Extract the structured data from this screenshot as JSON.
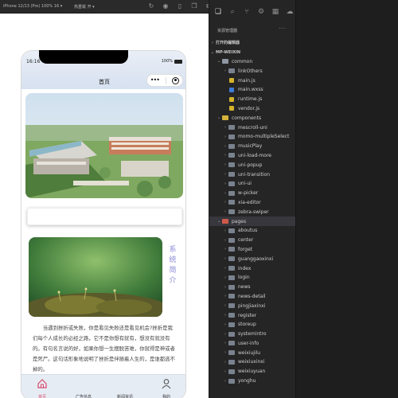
{
  "toolbar": {
    "device": "iPhone 12/13 (Pro) 100% 16 ▾",
    "hot_reload": "热重载 开 ▾",
    "icons": [
      "refresh-icon",
      "record-icon",
      "phone-icon",
      "copy-icon",
      "preview-icon"
    ]
  },
  "phone": {
    "time": "16:16",
    "battery": "100%",
    "nav_title": "首页",
    "intro_title": "系统简介",
    "intro_text": "当遇到挫折或失败，你是看见失败还是看见机会?挫折是我们每个人成长的必经之路，它不是你想有就有，想没有就没有的。有句名言说的好，如果你想一生摆脱苦难，你就得是神或者是死尸。这句话形象地说明了挫折是伴随着人生的，是谁都逃不掉的。",
    "tabs": [
      {
        "label": "首页",
        "active": true
      },
      {
        "label": "广告信息",
        "active": false
      },
      {
        "label": "新闻资讯",
        "active": false
      },
      {
        "label": "我的",
        "active": false
      }
    ]
  },
  "explorer": {
    "title": "资源管理器",
    "more": "···",
    "sections": {
      "open_editors": "打开的编辑器",
      "project": "MP-WEIXIN"
    },
    "tree": [
      {
        "label": "common",
        "type": "folder",
        "open": true,
        "depth": 1
      },
      {
        "label": "linkOthers",
        "type": "folder",
        "open": false,
        "depth": 2
      },
      {
        "label": "main.js",
        "type": "js",
        "depth": 2
      },
      {
        "label": "main.wxss",
        "type": "wxss",
        "depth": 2
      },
      {
        "label": "runtime.js",
        "type": "js",
        "depth": 2
      },
      {
        "label": "vendor.js",
        "type": "js",
        "depth": 2
      },
      {
        "label": "components",
        "type": "folder-yellow",
        "open": true,
        "depth": 1
      },
      {
        "label": "mescroll-uni",
        "type": "folder",
        "open": false,
        "depth": 2
      },
      {
        "label": "momo-multipleSelect",
        "type": "folder",
        "open": false,
        "depth": 2
      },
      {
        "label": "musicPlay",
        "type": "folder",
        "open": false,
        "depth": 2
      },
      {
        "label": "uni-load-more",
        "type": "folder",
        "open": false,
        "depth": 2
      },
      {
        "label": "uni-popup",
        "type": "folder",
        "open": false,
        "depth": 2
      },
      {
        "label": "uni-transition",
        "type": "folder",
        "open": false,
        "depth": 2
      },
      {
        "label": "uni-ui",
        "type": "folder",
        "open": false,
        "depth": 2
      },
      {
        "label": "w-picker",
        "type": "folder",
        "open": false,
        "depth": 2
      },
      {
        "label": "xia-editor",
        "type": "folder",
        "open": false,
        "depth": 2
      },
      {
        "label": "zebra-swiper",
        "type": "folder",
        "open": false,
        "depth": 2
      },
      {
        "label": "pages",
        "type": "folder-red",
        "open": true,
        "depth": 1,
        "selected": true
      },
      {
        "label": "aboutus",
        "type": "folder",
        "open": false,
        "depth": 2
      },
      {
        "label": "center",
        "type": "folder",
        "open": false,
        "depth": 2
      },
      {
        "label": "forget",
        "type": "folder",
        "open": false,
        "depth": 2
      },
      {
        "label": "guanggaoxinxi",
        "type": "folder",
        "open": false,
        "depth": 2
      },
      {
        "label": "index",
        "type": "folder",
        "open": false,
        "depth": 2
      },
      {
        "label": "login",
        "type": "folder",
        "open": false,
        "depth": 2
      },
      {
        "label": "news",
        "type": "folder",
        "open": false,
        "depth": 2
      },
      {
        "label": "news-detail",
        "type": "folder",
        "open": false,
        "depth": 2
      },
      {
        "label": "pingjiaxinxi",
        "type": "folder",
        "open": false,
        "depth": 2
      },
      {
        "label": "register",
        "type": "folder",
        "open": false,
        "depth": 2
      },
      {
        "label": "storeup",
        "type": "folder",
        "open": false,
        "depth": 2
      },
      {
        "label": "systemintro",
        "type": "folder",
        "open": false,
        "depth": 2
      },
      {
        "label": "user-info",
        "type": "folder",
        "open": false,
        "depth": 2
      },
      {
        "label": "weixiujilu",
        "type": "folder",
        "open": false,
        "depth": 2
      },
      {
        "label": "weixiuxinxi",
        "type": "folder",
        "open": false,
        "depth": 2
      },
      {
        "label": "weixiuyuan",
        "type": "folder",
        "open": false,
        "depth": 2
      },
      {
        "label": "yonghu",
        "type": "folder",
        "open": false,
        "depth": 2
      }
    ]
  },
  "colors": {
    "accent_pink": "#d94a6a",
    "intro_title": "#8a8ad6",
    "ide_bg": "#252526"
  }
}
